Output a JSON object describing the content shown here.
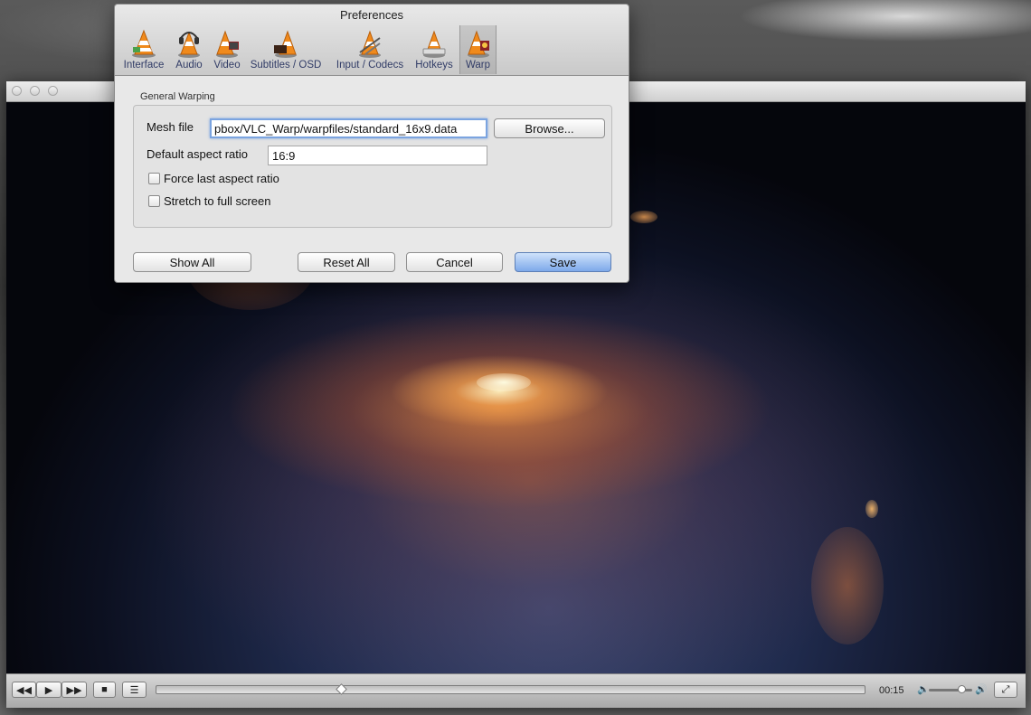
{
  "preferences": {
    "title": "Preferences",
    "toolbar": [
      {
        "label": "Interface",
        "icon": "vlc-cone-interface-icon"
      },
      {
        "label": "Audio",
        "icon": "vlc-cone-headphones-icon"
      },
      {
        "label": "Video",
        "icon": "vlc-cone-video-icon"
      },
      {
        "label": "Subtitles / OSD",
        "icon": "vlc-cone-subtitles-icon"
      },
      {
        "label": "Input / Codecs",
        "icon": "vlc-cone-codecs-icon"
      },
      {
        "label": "Hotkeys",
        "icon": "vlc-cone-hotkeys-icon"
      },
      {
        "label": "Warp",
        "icon": "vlc-cone-warp-icon",
        "active": true
      }
    ],
    "section_title": "General Warping",
    "mesh_file": {
      "label": "Mesh file",
      "value": "pbox/VLC_Warp/warpfiles/standard_16x9.data",
      "browse_label": "Browse..."
    },
    "aspect_ratio": {
      "label": "Default aspect ratio",
      "value": "16:9"
    },
    "force_last_aspect": {
      "label": "Force last aspect ratio",
      "checked": false
    },
    "stretch_full_screen": {
      "label": "Stretch to full screen",
      "checked": false
    },
    "buttons": {
      "show_all": "Show All",
      "reset_all": "Reset All",
      "cancel": "Cancel",
      "save": "Save"
    }
  },
  "player": {
    "elapsed_time": "00:15",
    "playback_position": 0.26,
    "volume_level": 0.75,
    "accent_color": "#7ea9ea"
  }
}
